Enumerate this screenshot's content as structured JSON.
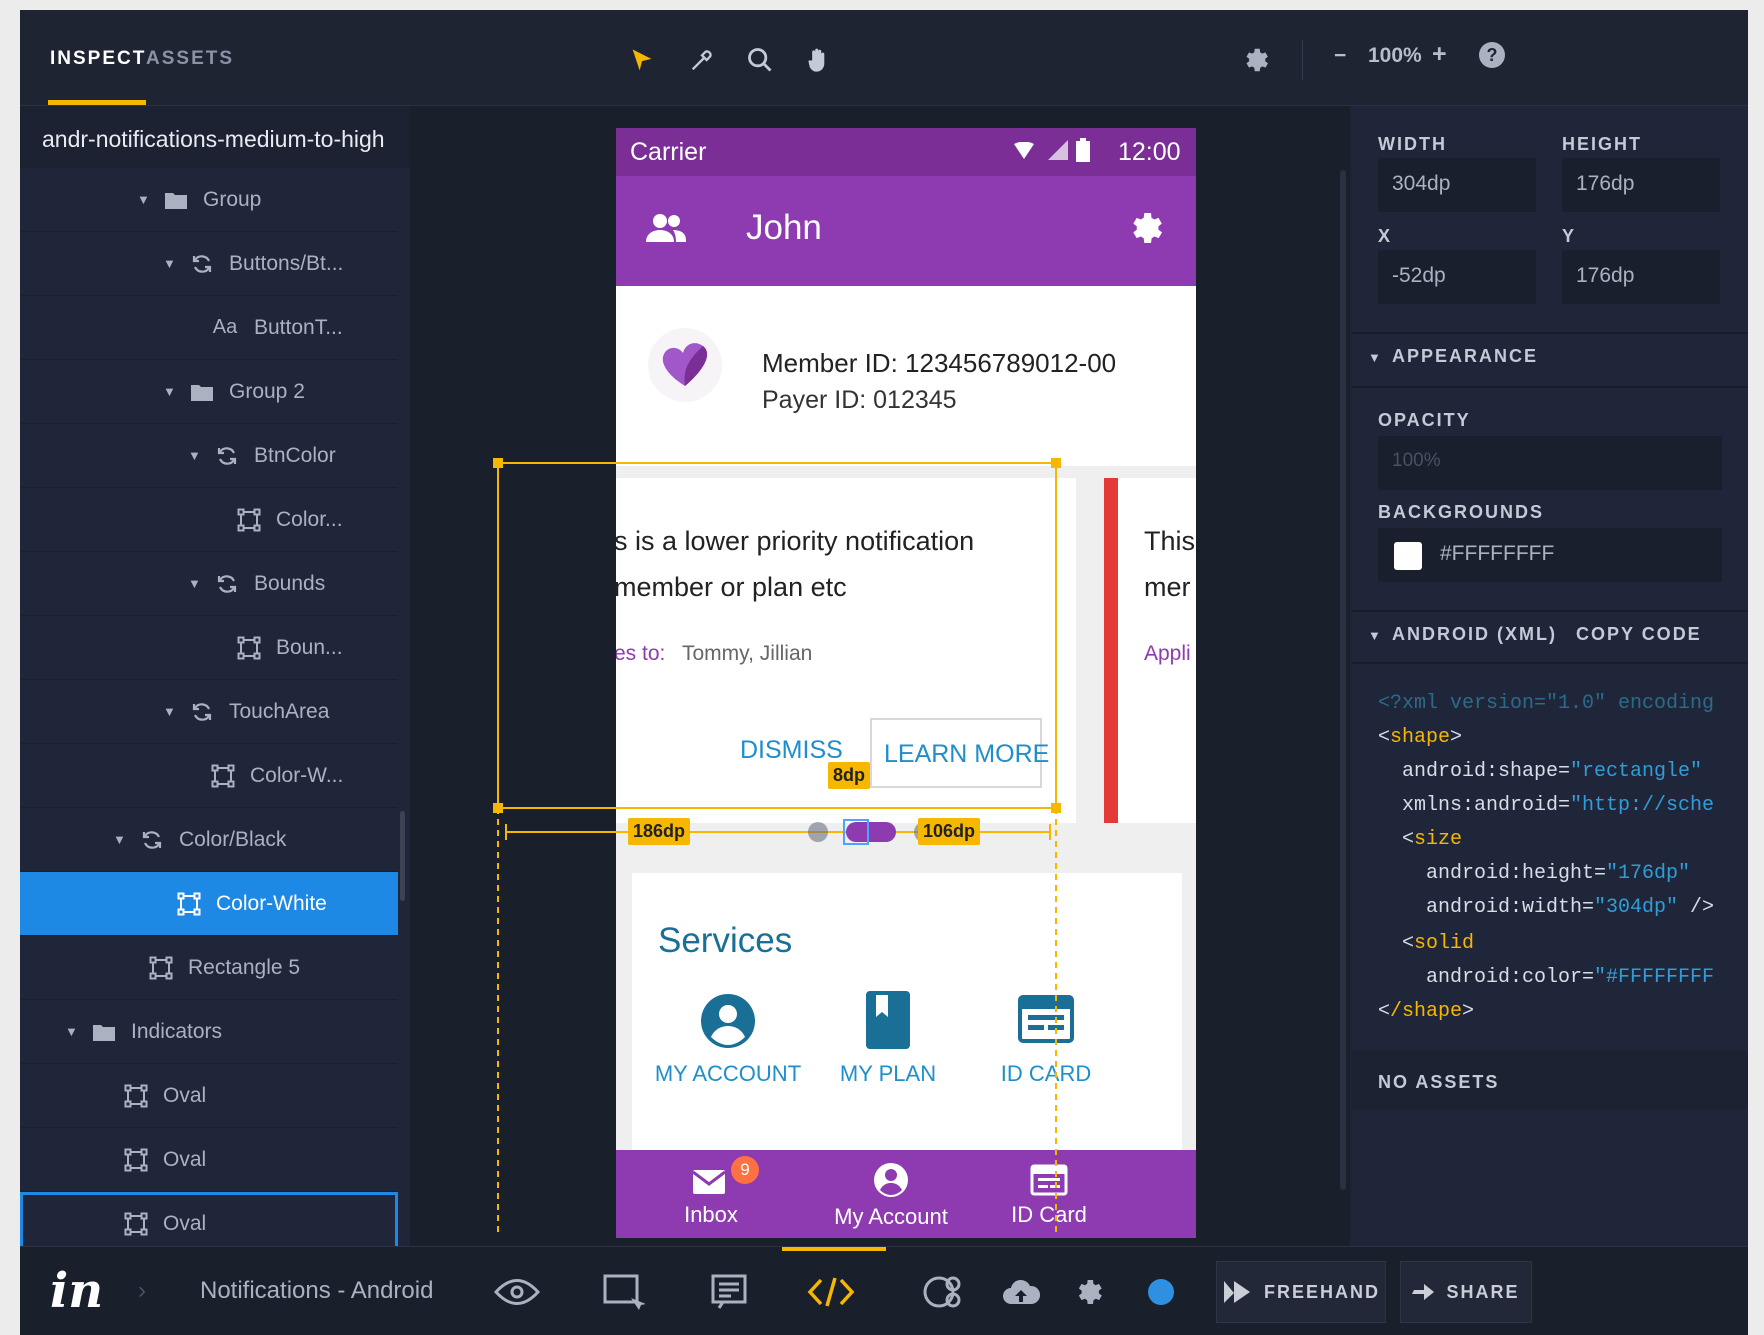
{
  "topbar": {
    "tabs": [
      {
        "label": "INSPECT"
      },
      {
        "label": "ASSETS"
      }
    ],
    "zoom": {
      "minus": "−",
      "value": "100%",
      "plus": "+",
      "help": "?"
    },
    "tools": [
      "pointer-icon",
      "eyedropper-icon",
      "search-icon",
      "hand-icon"
    ]
  },
  "layers": {
    "title": "andr-notifications-medium-to-high",
    "items": [
      {
        "label": "Group",
        "icon": "folder-icon"
      },
      {
        "label": "Buttons/Bt...",
        "icon": "symbol-icon"
      },
      {
        "label": "ButtonT...",
        "icon": "text-icon",
        "icon_text": "Aa"
      },
      {
        "label": "Group 2",
        "icon": "folder-icon"
      },
      {
        "label": "BtnColor",
        "icon": "symbol-icon"
      },
      {
        "label": "Color...",
        "icon": "shape-icon"
      },
      {
        "label": "Bounds",
        "icon": "symbol-icon"
      },
      {
        "label": "Boun...",
        "icon": "shape-icon"
      },
      {
        "label": "TouchArea",
        "icon": "symbol-icon"
      },
      {
        "label": "Color-W...",
        "icon": "shape-icon"
      },
      {
        "label": "Color/Black",
        "icon": "symbol-icon"
      },
      {
        "label": "Color-White",
        "icon": "shape-icon",
        "selected": true
      },
      {
        "label": "Rectangle 5",
        "icon": "shape-icon"
      },
      {
        "label": "Indicators",
        "icon": "folder-icon"
      },
      {
        "label": "Oval",
        "icon": "shape-icon"
      },
      {
        "label": "Oval",
        "icon": "shape-icon"
      },
      {
        "label": "Oval",
        "icon": "shape-icon"
      }
    ]
  },
  "phone": {
    "status": {
      "carrier": "Carrier",
      "time": "12:00"
    },
    "appbar": {
      "title": "John"
    },
    "member": {
      "member_id": "Member ID: 123456789012-00",
      "payer_id": "Payer ID: 012345"
    },
    "card1": {
      "line1": "s is a lower priority notification",
      "line2": "member or plan etc",
      "applies_label": "es to:",
      "applies_value": "Tommy, Jillian",
      "dismiss": "DISMISS",
      "learn_more": "LEARN MORE"
    },
    "card2": {
      "line1": "This",
      "line2": "mer",
      "line3": "Appli"
    },
    "services": {
      "title": "Services",
      "items": [
        {
          "label": "MY ACCOUNT"
        },
        {
          "label": "MY PLAN"
        },
        {
          "label": "ID CARD"
        }
      ]
    },
    "bottom_nav": {
      "items": [
        {
          "label": "Inbox",
          "badge": "9"
        },
        {
          "label": "My Account"
        },
        {
          "label": "ID Card"
        }
      ]
    }
  },
  "measure": {
    "left": "186dp",
    "right": "106dp",
    "gap": "8dp"
  },
  "props": {
    "width_label": "WIDTH",
    "width": "304dp",
    "height_label": "HEIGHT",
    "height": "176dp",
    "x_label": "X",
    "x": "-52dp",
    "y_label": "Y",
    "y": "176dp",
    "appearance_label": "APPEARANCE",
    "opacity_label": "OPACITY",
    "opacity": "100%",
    "backgrounds_label": "BACKGROUNDS",
    "background": "#FFFFFFFF",
    "android_label": "ANDROID (XML)",
    "copy_code": "COPY CODE",
    "code": {
      "l1": "<?xml version=\"1.0\" encoding",
      "l2_tag": "shape",
      "l3_attr": "android:shape=",
      "l3_val": "\"rectangle\"",
      "l4_attr": "xmlns:android=",
      "l4_val": "\"http://sche",
      "l5_tag": "size",
      "l6_attr": "android:height=",
      "l6_val": "\"176dp\"",
      "l7_attr": "android:width=",
      "l7_val": "\"304dp\"",
      "l7_end": " />",
      "l8_tag": "solid",
      "l9_attr": "android:color=",
      "l9_val": "\"#FFFFFFFF",
      "l10_tag": "/shape"
    },
    "no_assets": "NO ASSETS"
  },
  "footer": {
    "project": "Notifications - Android",
    "freehand": "FREEHAND",
    "share": "SHARE",
    "logo": "in"
  },
  "colors": {
    "accent": "#f5b700",
    "brand_purple": "#8e3ab0",
    "selection": "#1e88e5",
    "link_blue": "#1f8ecb"
  }
}
